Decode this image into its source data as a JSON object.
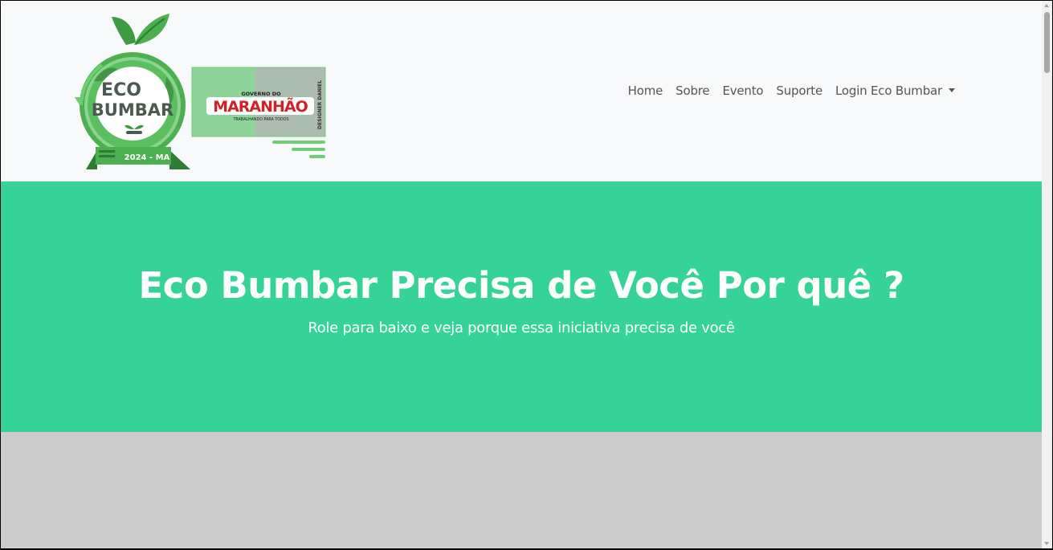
{
  "nav": {
    "items": [
      "Home",
      "Sobre",
      "Evento",
      "Suporte"
    ],
    "dropdown_label": "Login Eco Bumbar"
  },
  "logo": {
    "title_line1": "ECO",
    "title_line2": "BUMBAR",
    "year": "2024 - MA",
    "gov_line1": "GOVERNO DO",
    "gov_line2": "MARANHÃO",
    "gov_tagline": "TRABALHANDO PARA TODOS",
    "designer": "DESIGNER DANIEL"
  },
  "hero": {
    "title": "Eco Bumbar Precisa de Você Por quê ?",
    "subtitle": "Role para baixo e veja porque essa iniciativa precisa de você"
  },
  "colors": {
    "hero_bg": "#36d399",
    "navbar_bg": "#f8f9fa",
    "section_bg": "#cccccc",
    "brand_green": "#3a9a3e"
  }
}
